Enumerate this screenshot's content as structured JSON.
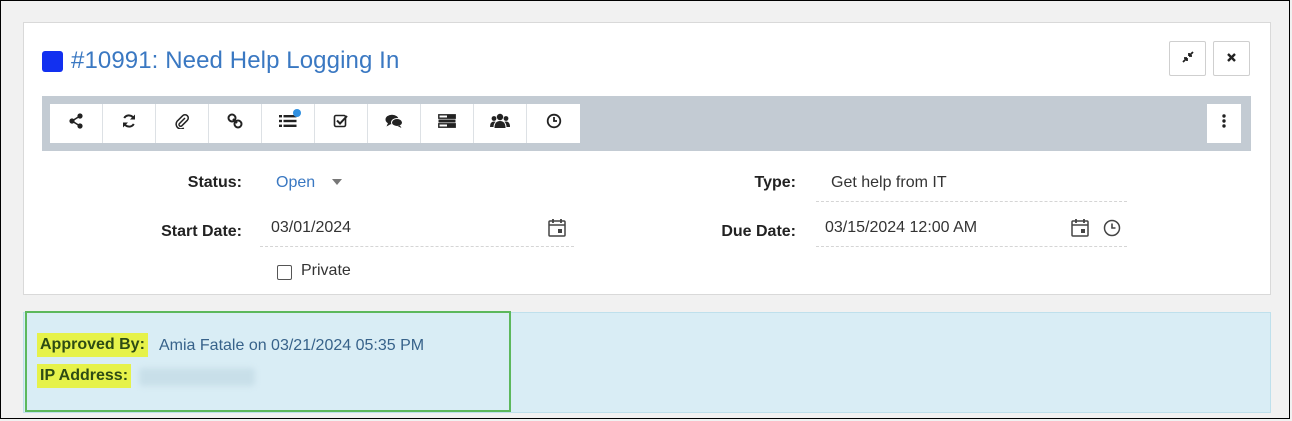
{
  "ticket": {
    "title": "#10991: Need Help Logging In",
    "color": "#1230f0"
  },
  "window_controls": {
    "minimize_icon": "compress-icon",
    "close_icon": "close-icon"
  },
  "toolbar": {
    "buttons": [
      {
        "icon": "share-icon"
      },
      {
        "icon": "refresh-icon"
      },
      {
        "icon": "paperclip-icon"
      },
      {
        "icon": "link-icon"
      },
      {
        "icon": "list-icon",
        "has_notification": true
      },
      {
        "icon": "checkbox-icon"
      },
      {
        "icon": "comments-icon"
      },
      {
        "icon": "fields-icon"
      },
      {
        "icon": "users-icon"
      },
      {
        "icon": "clock-icon"
      }
    ],
    "more_icon": "ellipsis-vertical-icon"
  },
  "fields": {
    "status_label": "Status:",
    "status_value": "Open",
    "type_label": "Type:",
    "type_value": "Get help from IT",
    "start_date_label": "Start Date:",
    "start_date_value": "03/01/2024",
    "due_date_label": "Due Date:",
    "due_date_value": "03/15/2024 12:00 AM",
    "private_label": "Private",
    "private_checked": false
  },
  "approval": {
    "approved_by_label": "Approved By:",
    "approved_by_value": "Amia Fatale on 03/21/2024 05:35 PM",
    "ip_label": "IP Address:",
    "ip_value": ""
  }
}
